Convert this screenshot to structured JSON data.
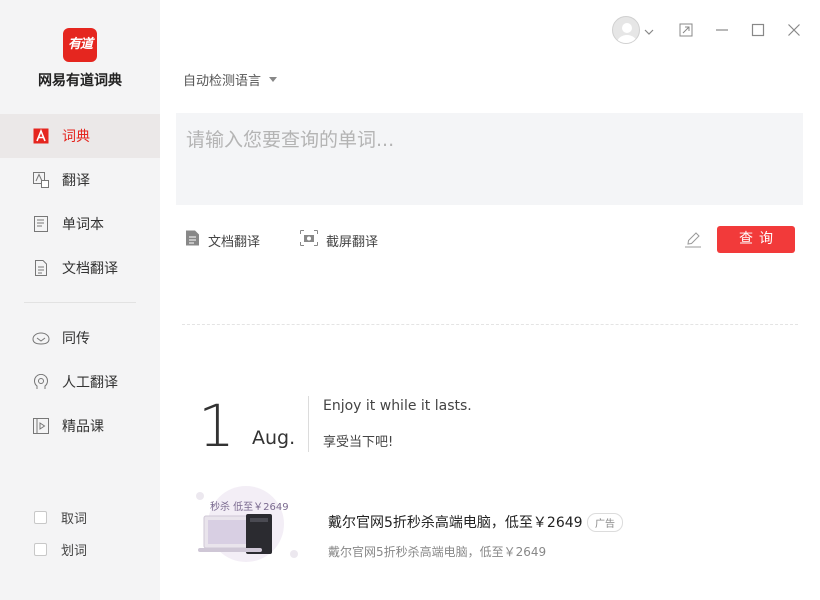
{
  "app": {
    "name": "网易有道词典",
    "logo_text": "有道",
    "brand_color": "#e5261f"
  },
  "sidebar": {
    "items": [
      {
        "label": "词典",
        "icon": "dictionary-icon",
        "active": true
      },
      {
        "label": "翻译",
        "icon": "translate-icon",
        "active": false
      },
      {
        "label": "单词本",
        "icon": "wordbook-icon",
        "active": false
      },
      {
        "label": "文档翻译",
        "icon": "document-icon",
        "active": false
      },
      {
        "label": "同传",
        "icon": "simultaneous-icon",
        "active": false
      },
      {
        "label": "人工翻译",
        "icon": "human-translate-icon",
        "active": false
      },
      {
        "label": "精品课",
        "icon": "course-icon",
        "active": false
      }
    ],
    "checks": [
      {
        "label": "取词",
        "checked": false
      },
      {
        "label": "划词",
        "checked": false
      }
    ]
  },
  "main": {
    "language_select": "自动检测语言",
    "search_placeholder": "请输入您要查询的单词...",
    "search_value": "",
    "tools": {
      "doc_translate": "文档翻译",
      "screenshot_translate": "截屏翻译"
    },
    "query_button": "查询"
  },
  "daily": {
    "day": "1",
    "month": "Aug.",
    "sentence_en": "Enjoy it while it lasts.",
    "sentence_cn": "享受当下吧!"
  },
  "ad": {
    "title": "戴尔官网5折秒杀高端电脑，低至￥2649",
    "badge": "广告",
    "subtitle": "戴尔官网5折秒杀高端电脑，低至￥2649",
    "image_text": "秒杀 低至￥2649"
  }
}
